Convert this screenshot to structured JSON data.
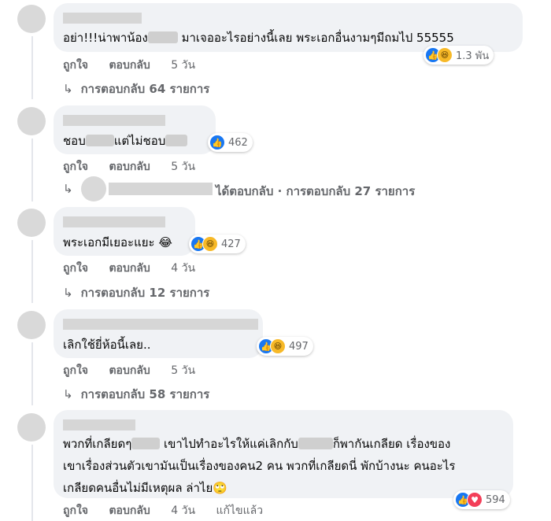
{
  "comments": [
    {
      "text_before": "อย่า!!!น่าพาน้อง",
      "text_after": " มาเจออะไรอย่างนี้เลย พระเอกอื่นงามๆมีถมไป 55555",
      "like_label": "ถูกใจ",
      "reply_label": "ตอบกลับ",
      "time": "5 วัน",
      "reactions_count": "1.3 พัน",
      "replies_link": "การตอบกลับ 64 รายการ"
    },
    {
      "text_part1": "ชอบ",
      "text_part2": "แต่ไม่ชอบ",
      "like_label": "ถูกใจ",
      "reply_label": "ตอบกลับ",
      "time": "5 วัน",
      "reactions_count": "462",
      "replies_summary": "ได้ตอบกลับ · การตอบกลับ 27 รายการ"
    },
    {
      "text": "พระเอกมีเยอะแยะ 😂",
      "like_label": "ถูกใจ",
      "reply_label": "ตอบกลับ",
      "time": "4 วัน",
      "reactions_count": "427",
      "replies_link": "การตอบกลับ 12 รายการ"
    },
    {
      "text": "เลิกใช้ยี่ห้อนี้เลย..",
      "like_label": "ถูกใจ",
      "reply_label": "ตอบกลับ",
      "time": "5 วัน",
      "reactions_count": "497",
      "replies_link": "การตอบกลับ 58 รายการ"
    },
    {
      "line1_a": "พวกที่เกลียดๆ",
      "line1_b": " เขาไปทำอะไรให้แค่เลิกกับ",
      "line1_c": "ก็พากันเกลียด เรื่องของ",
      "line2": "เขาเรื่องส่วนตัวเขามันเป็นเรื่องของคน2 คน พวกที่เกลียดนี่ พักบ้างนะ คนอะไร",
      "line3": "เกลียดคนอื่นไม่มีเหตุผล ล่าไย🙄",
      "like_label": "ถูกใจ",
      "reply_label": "ตอบกลับ",
      "time": "4 วัน",
      "edited_label": "แก้ไขแล้ว",
      "reactions_count": "594"
    }
  ],
  "icons": {
    "reply_arrow": "reply-arrow-icon",
    "like": "like-reaction-icon",
    "haha": "haha-reaction-icon",
    "love": "love-reaction-icon"
  },
  "colors": {
    "bubble": "#f0f2f5",
    "secondary_text": "#65676b",
    "like_blue": "#1877f2",
    "haha_yellow": "#f7b928",
    "love_red": "#f33e58"
  }
}
